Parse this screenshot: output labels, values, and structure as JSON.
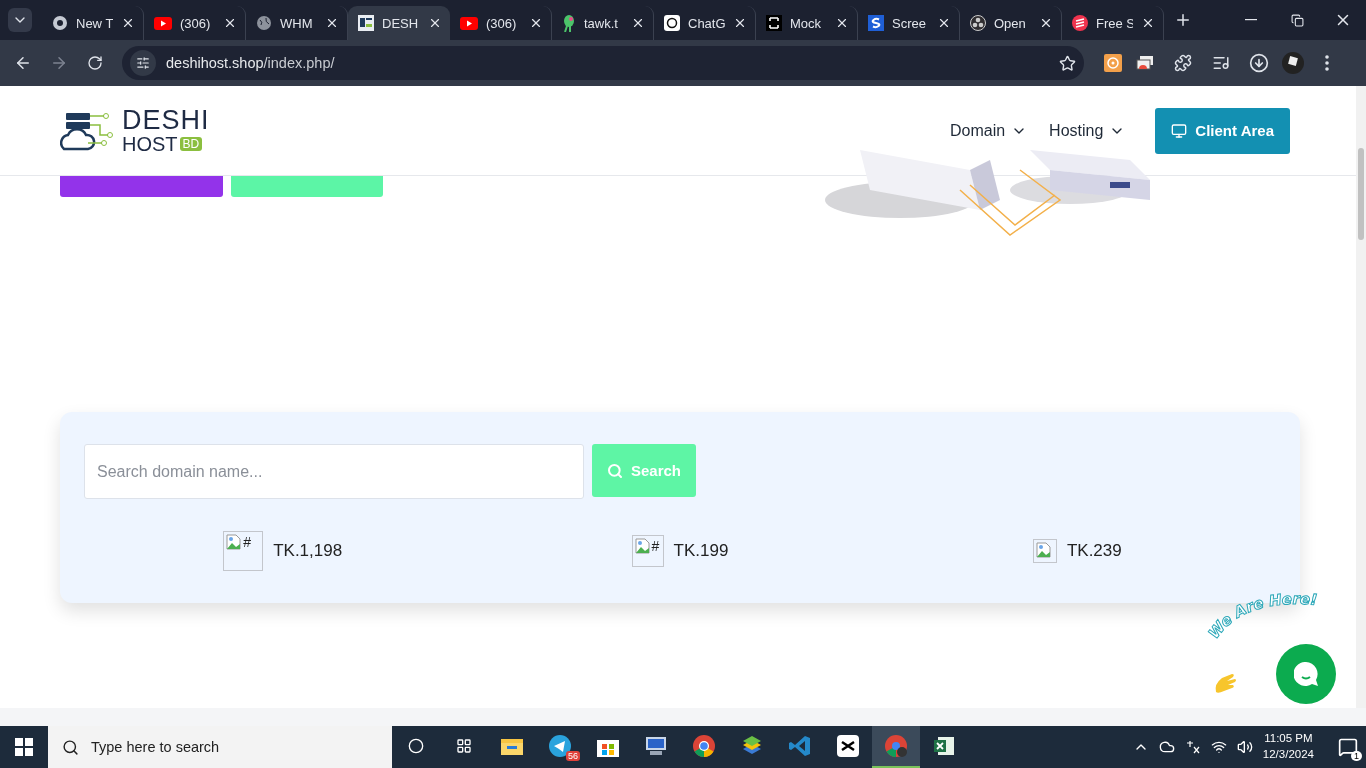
{
  "browser": {
    "tabs": [
      {
        "title": "New T",
        "kind": "chrome",
        "selected": false
      },
      {
        "title": "(306)",
        "kind": "youtube",
        "selected": false
      },
      {
        "title": "WHM",
        "kind": "globe",
        "selected": false
      },
      {
        "title": "DESH",
        "kind": "site",
        "selected": true
      },
      {
        "title": "(306)",
        "kind": "youtube",
        "selected": false
      },
      {
        "title": "tawk.t",
        "kind": "parrot",
        "selected": false
      },
      {
        "title": "ChatG",
        "kind": "chatgpt",
        "selected": false
      },
      {
        "title": "Mock",
        "kind": "mock",
        "selected": false
      },
      {
        "title": "Scree",
        "kind": "letter",
        "selected": false
      },
      {
        "title": "Open",
        "kind": "obs",
        "selected": false
      },
      {
        "title": "Free S",
        "kind": "free",
        "selected": false
      }
    ],
    "url_host": "deshihost.shop",
    "url_path": "/index.php/"
  },
  "site": {
    "logo": {
      "top": "DESHI",
      "bottom": "HOST",
      "tag": "BD"
    },
    "nav": [
      {
        "label": "Domain"
      },
      {
        "label": "Hosting"
      }
    ],
    "client_button": "Client Area",
    "hero_buttons": [
      {
        "kind": "primary"
      },
      {
        "kind": "chat"
      }
    ],
    "domain_search": {
      "placeholder": "Search domain name...",
      "button": "Search",
      "prices": [
        {
          "alt": "#",
          "price": "TK.1,198"
        },
        {
          "alt": "#",
          "price": "TK.199"
        },
        {
          "price": "TK.239"
        }
      ]
    },
    "chat_widget": {
      "caption": "We Are Here!"
    }
  },
  "taskbar": {
    "search_placeholder": "Type here to search",
    "telegram_badge": "56",
    "time": "11:05 PM",
    "date": "12/3/2024",
    "notifications": "1"
  }
}
